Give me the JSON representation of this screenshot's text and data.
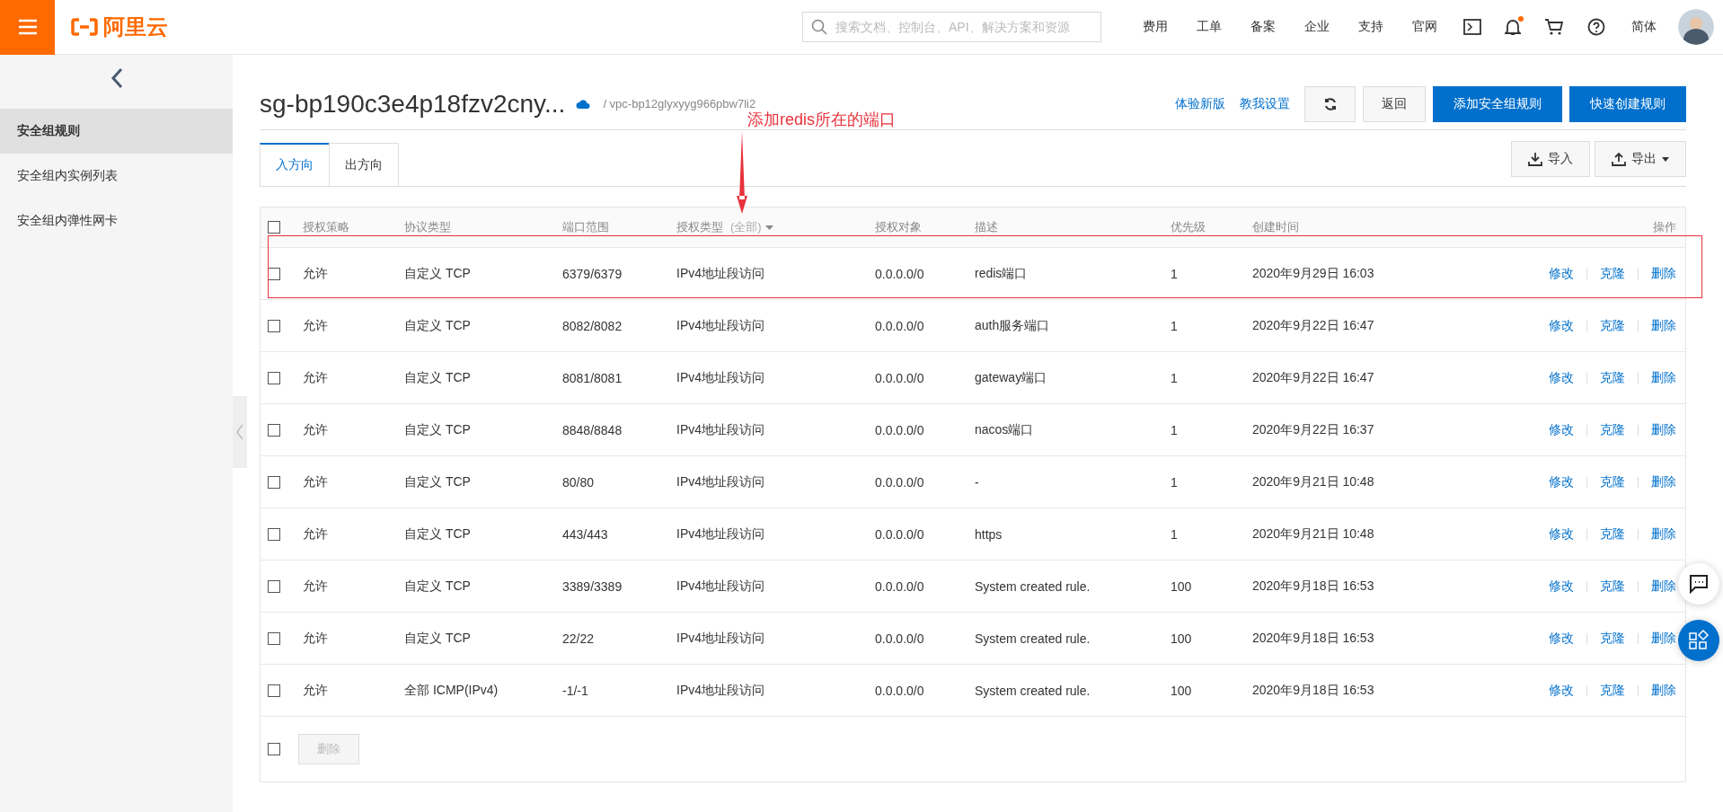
{
  "topbar": {
    "logo": "阿里云",
    "search": {
      "placeholder": "搜索文档、控制台、API、解决方案和资源"
    },
    "nav": [
      "费用",
      "工单",
      "备案",
      "企业",
      "支持",
      "官网"
    ],
    "notification_dot": true,
    "language": "简体"
  },
  "sidebar": {
    "items": [
      {
        "label": "安全组规则",
        "selected": true
      },
      {
        "label": "安全组内实例列表",
        "selected": false
      },
      {
        "label": "安全组内弹性网卡",
        "selected": false
      }
    ]
  },
  "header": {
    "title": "sg-bp190c3e4p18fzv2cny...",
    "vpc": "/ vpc-bp12glyxyyg966pbw7li2",
    "links": [
      "体验新版",
      "教我设置"
    ],
    "buttons": [
      {
        "kind": "refresh"
      },
      {
        "kind": "default",
        "label": "返回"
      },
      {
        "kind": "primary",
        "label": "添加安全组规则"
      },
      {
        "kind": "primary",
        "label": "快速创建规则"
      }
    ]
  },
  "tabs": [
    {
      "label": "入方向",
      "selected": true
    },
    {
      "label": "出方向",
      "selected": false
    }
  ],
  "tools": [
    {
      "kind": "import",
      "label": "导入"
    },
    {
      "kind": "export",
      "label": "导出"
    }
  ],
  "table": {
    "all_checked": false,
    "columns": [
      {
        "label": "授权策略"
      },
      {
        "label": "协议类型"
      },
      {
        "label": "端口范围"
      },
      {
        "label": "授权类型",
        "filter": "(全部)"
      },
      {
        "label": "授权对象"
      },
      {
        "label": "描述"
      },
      {
        "label": "优先级"
      },
      {
        "label": "创建时间"
      },
      {
        "label": "操作"
      }
    ],
    "rows": [
      {
        "checked": false,
        "highlighted": true,
        "cells": [
          "允许",
          "自定义 TCP",
          "6379/6379",
          "IPv4地址段访问",
          "0.0.0.0/0",
          "redis端口",
          "1",
          "2020年9月29日 16:03"
        ],
        "actions": [
          "修改",
          "克隆",
          "删除"
        ]
      },
      {
        "checked": false,
        "highlighted": false,
        "cells": [
          "允许",
          "自定义 TCP",
          "8082/8082",
          "IPv4地址段访问",
          "0.0.0.0/0",
          "auth服务端口",
          "1",
          "2020年9月22日 16:47"
        ],
        "actions": [
          "修改",
          "克隆",
          "删除"
        ]
      },
      {
        "checked": false,
        "highlighted": false,
        "cells": [
          "允许",
          "自定义 TCP",
          "8081/8081",
          "IPv4地址段访问",
          "0.0.0.0/0",
          "gateway端口",
          "1",
          "2020年9月22日 16:47"
        ],
        "actions": [
          "修改",
          "克隆",
          "删除"
        ]
      },
      {
        "checked": false,
        "highlighted": false,
        "cells": [
          "允许",
          "自定义 TCP",
          "8848/8848",
          "IPv4地址段访问",
          "0.0.0.0/0",
          "nacos端口",
          "1",
          "2020年9月22日 16:37"
        ],
        "actions": [
          "修改",
          "克隆",
          "删除"
        ]
      },
      {
        "checked": false,
        "highlighted": false,
        "cells": [
          "允许",
          "自定义 TCP",
          "80/80",
          "IPv4地址段访问",
          "0.0.0.0/0",
          "-",
          "1",
          "2020年9月21日 10:48"
        ],
        "actions": [
          "修改",
          "克隆",
          "删除"
        ]
      },
      {
        "checked": false,
        "highlighted": false,
        "cells": [
          "允许",
          "自定义 TCP",
          "443/443",
          "IPv4地址段访问",
          "0.0.0.0/0",
          "https",
          "1",
          "2020年9月21日 10:48"
        ],
        "actions": [
          "修改",
          "克隆",
          "删除"
        ]
      },
      {
        "checked": false,
        "highlighted": false,
        "cells": [
          "允许",
          "自定义 TCP",
          "3389/3389",
          "IPv4地址段访问",
          "0.0.0.0/0",
          "System created rule.",
          "100",
          "2020年9月18日 16:53"
        ],
        "actions": [
          "修改",
          "克隆",
          "删除"
        ]
      },
      {
        "checked": false,
        "highlighted": false,
        "cells": [
          "允许",
          "自定义 TCP",
          "22/22",
          "IPv4地址段访问",
          "0.0.0.0/0",
          "System created rule.",
          "100",
          "2020年9月18日 16:53"
        ],
        "actions": [
          "修改",
          "克隆",
          "删除"
        ]
      },
      {
        "checked": false,
        "highlighted": false,
        "cells": [
          "允许",
          "全部 ICMP(IPv4)",
          "-1/-1",
          "IPv4地址段访问",
          "0.0.0.0/0",
          "System created rule.",
          "100",
          "2020年9月18日 16:53"
        ],
        "actions": [
          "修改",
          "克隆",
          "删除"
        ]
      }
    ],
    "footer": {
      "checked": false,
      "button": {
        "label": "删除",
        "disabled": true
      }
    }
  },
  "annotation": {
    "text": "添加redis所在的端口"
  }
}
